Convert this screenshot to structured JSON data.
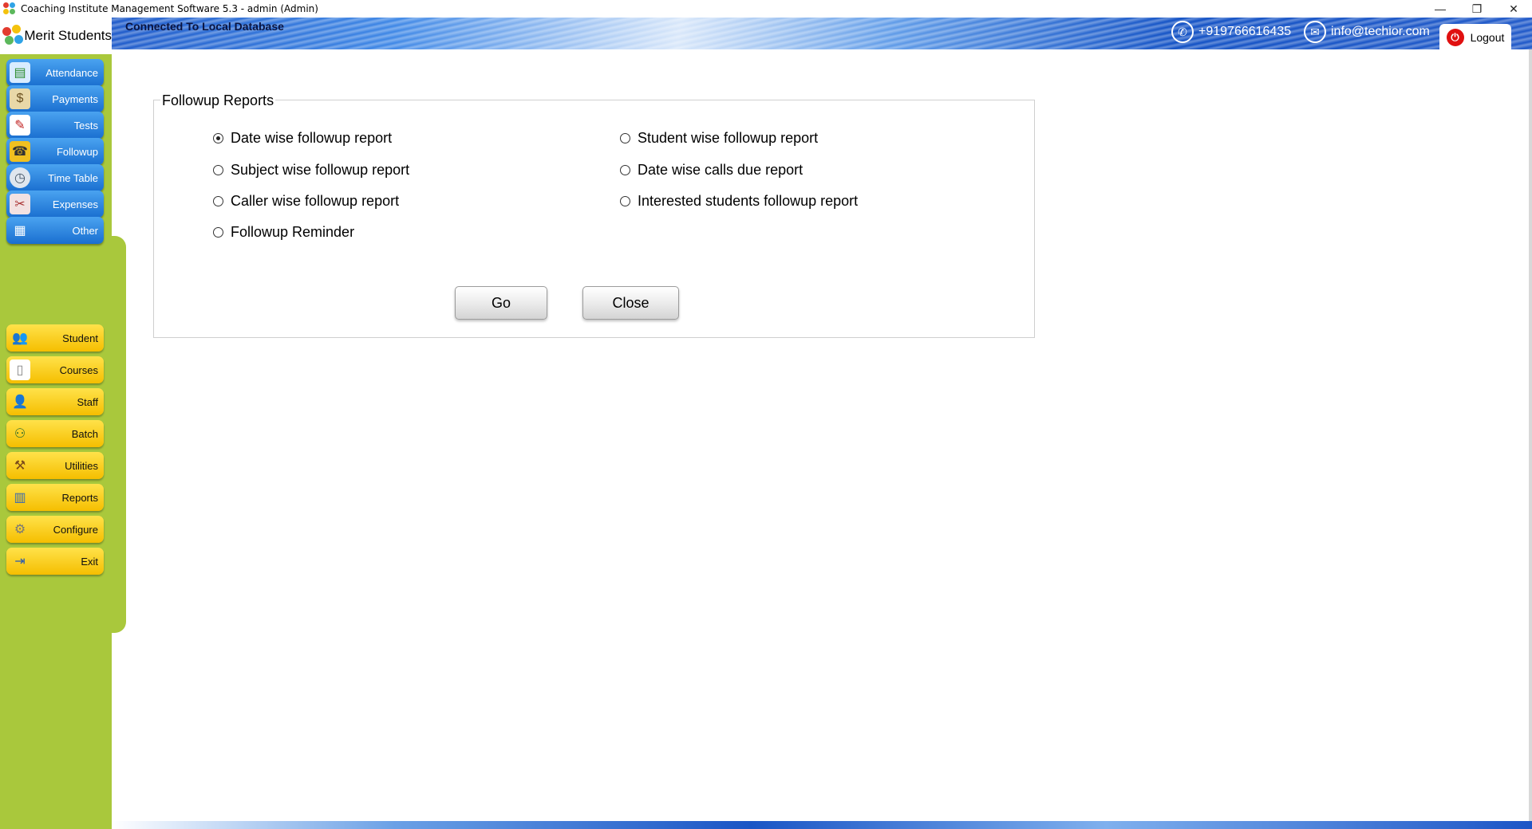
{
  "window": {
    "title": "Coaching Institute Management Software 5.3  -  admin (Admin)",
    "minimize": "—",
    "maximize": "❐",
    "close": "✕"
  },
  "header": {
    "connection_status": "Connected To  Local Database",
    "phone": "+919766616435",
    "email": "info@techior.com",
    "logout_label": "Logout"
  },
  "sidebar": {
    "brand": "Merit Students",
    "primary_items": [
      {
        "label": "Attendance",
        "icon": "attendance-icon"
      },
      {
        "label": "Payments",
        "icon": "payments-icon"
      },
      {
        "label": "Tests",
        "icon": "tests-icon"
      },
      {
        "label": "Followup",
        "icon": "followup-icon"
      },
      {
        "label": "Time Table",
        "icon": "clock-icon"
      },
      {
        "label": "Expenses",
        "icon": "expenses-icon"
      },
      {
        "label": "Other",
        "icon": "grid-icon"
      }
    ],
    "secondary_items": [
      {
        "label": "Student",
        "icon": "student-icon"
      },
      {
        "label": "Courses",
        "icon": "courses-icon"
      },
      {
        "label": "Staff",
        "icon": "staff-icon"
      },
      {
        "label": "Batch",
        "icon": "batch-icon"
      },
      {
        "label": "Utilities",
        "icon": "utilities-icon"
      },
      {
        "label": "Reports",
        "icon": "reports-icon"
      },
      {
        "label": "Configure",
        "icon": "gear-icon"
      },
      {
        "label": "Exit",
        "icon": "exit-icon"
      }
    ]
  },
  "report_panel": {
    "title": "Followup Reports",
    "options_left": [
      {
        "label": "Date wise followup report",
        "checked": true
      },
      {
        "label": "Subject wise followup report",
        "checked": false
      },
      {
        "label": "Caller wise followup report",
        "checked": false
      },
      {
        "label": "Followup Reminder",
        "checked": false
      }
    ],
    "options_right": [
      {
        "label": "Student wise followup report",
        "checked": false
      },
      {
        "label": "Date wise calls due report",
        "checked": false
      },
      {
        "label": "Interested students followup report",
        "checked": false
      }
    ],
    "go_label": "Go",
    "close_label": "Close"
  },
  "colors": {
    "sidebar_green": "#a9c83c",
    "nav_blue": "#1a6fd0",
    "nav_yellow": "#f5be00",
    "logout_red": "#e01010"
  }
}
